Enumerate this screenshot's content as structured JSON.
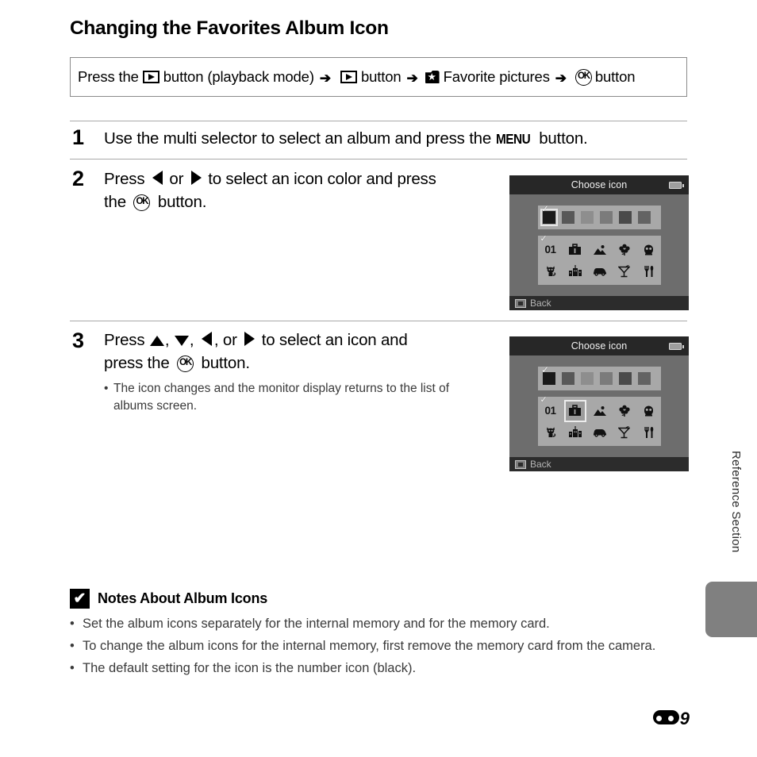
{
  "page": {
    "title": "Changing the Favorites Album Icon",
    "side_label": "Reference Section",
    "page_number": "9",
    "page_prefix_icon": "reference-section-symbol"
  },
  "breadcrumb": {
    "prefix": "Press the",
    "seg1_label": "button (playback mode)",
    "seg2_label": "button",
    "seg3_label": "Favorite pictures",
    "seg4_label": "button",
    "icons": {
      "playback": "playback-button-icon",
      "arrow": "➔",
      "favorites": "favorite-pictures-icon",
      "ok": "ok-button-icon"
    }
  },
  "steps": [
    {
      "number": "1",
      "text_before_menu": "Use the multi selector to select an album and press the",
      "menu_label": "MENU",
      "text_after_menu": "button."
    },
    {
      "number": "2",
      "line1_a": "Press",
      "line1_b": "or",
      "line1_c": "to select an icon color and press",
      "line2_a": "the",
      "line2_b": "button.",
      "bullets": []
    },
    {
      "number": "3",
      "line1_a": "Press",
      "line1_b": ",",
      "line1_c": ",",
      "line1_d": ", or",
      "line1_e": "to select an icon and",
      "line2_a": "press the",
      "line2_b": "button.",
      "bullets": [
        "The icon changes and the monitor display returns to the list of albums screen."
      ]
    }
  ],
  "camera_screens": [
    {
      "id": "step2-screen",
      "title": "Choose icon",
      "back_label": "Back",
      "battery_icon": "battery-icon",
      "selection": "color",
      "selected_color_index": 0,
      "selected_icon_index": null,
      "color_swatches": [
        "#1a1a1a",
        "#585858",
        "#8e8e8e",
        "#7b7b7b",
        "#4a4a4a",
        "#636363"
      ],
      "icons_row1": [
        "01",
        "briefcase",
        "mountain",
        "flower",
        "face"
      ],
      "icons_row2": [
        "cat",
        "buildings",
        "car",
        "cocktail",
        "cutlery"
      ],
      "icon_glyphs_row1": [
        "01",
        "💼",
        "⛰",
        "❀",
        "☺"
      ],
      "icon_glyphs_row2": [
        "🐈",
        "🏘",
        "🚗",
        "🍸",
        "🍴"
      ]
    },
    {
      "id": "step3-screen",
      "title": "Choose icon",
      "back_label": "Back",
      "battery_icon": "battery-icon",
      "selection": "icon",
      "selected_color_index": 0,
      "selected_icon_index": 1,
      "color_swatches": [
        "#1a1a1a",
        "#585858",
        "#8e8e8e",
        "#7b7b7b",
        "#4a4a4a",
        "#636363"
      ],
      "icons_row1": [
        "01",
        "briefcase",
        "mountain",
        "flower",
        "face"
      ],
      "icons_row2": [
        "cat",
        "buildings",
        "car",
        "cocktail",
        "cutlery"
      ],
      "icon_glyphs_row1": [
        "01",
        "💼",
        "⛰",
        "❀",
        "☺"
      ],
      "icon_glyphs_row2": [
        "🐈",
        "🏘",
        "🚗",
        "🍸",
        "🍴"
      ]
    }
  ],
  "notes": {
    "title": "Notes About Album Icons",
    "mark_icon": "caution-check-icon",
    "items": [
      "Set the album icons separately for the internal memory and for the memory card.",
      "To change the album icons for the internal memory, first remove the memory card from the camera.",
      "The default setting for the icon is the number icon (black)."
    ]
  }
}
